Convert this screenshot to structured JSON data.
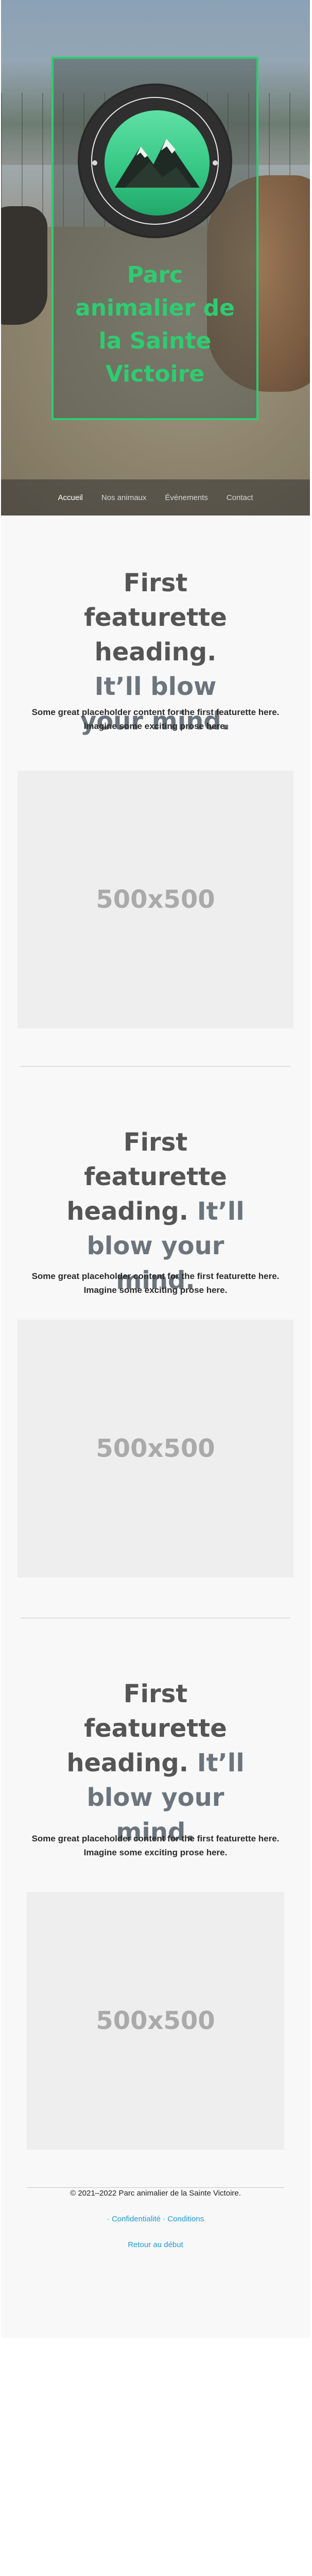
{
  "hero": {
    "title": "Parc animalier de la Sainte Victoire",
    "brand_color": "#2ecc71"
  },
  "nav": {
    "items": [
      {
        "label": "Accueil",
        "active": true
      },
      {
        "label": "Nos animaux",
        "active": false
      },
      {
        "label": "Événements",
        "active": false
      },
      {
        "label": "Contact",
        "active": false
      }
    ]
  },
  "featurettes": [
    {
      "heading_main": "First featurette heading.",
      "heading_muted": "It’ll blow your mind.",
      "lead": "Some great placeholder content for the first featurette here. Imagine some exciting prose here.",
      "image_label": "500x500"
    },
    {
      "heading_main": "First featurette heading.",
      "heading_muted": "It’ll blow your mind.",
      "lead": "Some great placeholder content for the first featurette here. Imagine some exciting prose here.",
      "image_label": "500x500"
    },
    {
      "heading_main": "First featurette heading.",
      "heading_muted": "It’ll blow your mind.",
      "lead": "Some great placeholder content for the first featurette here. Imagine some exciting prose here.",
      "image_label": "500x500"
    }
  ],
  "footer": {
    "copyright": "© 2021–2022 Parc animalier de la Sainte Victoire.",
    "privacy_label": "Confidentialité",
    "terms_label": "Conditions",
    "back_to_top": "Retour au début",
    "link_color": "#1e9bd7"
  }
}
